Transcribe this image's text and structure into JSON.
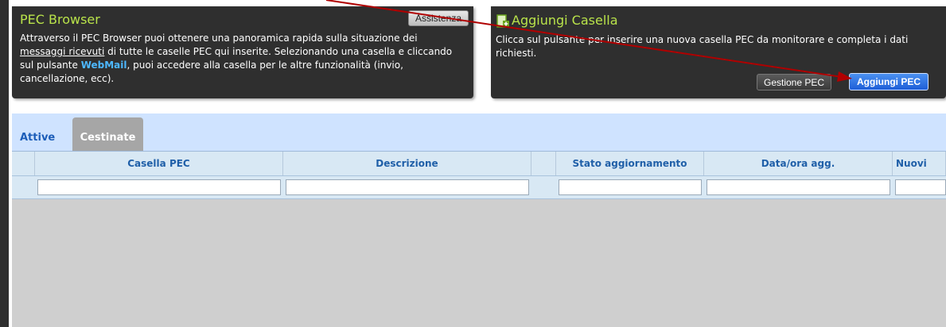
{
  "pec_browser": {
    "title": "PEC Browser",
    "assistenza_label": "Assistenza",
    "desc_part1": "Attraverso il PEC Browser puoi ottenere una panoramica rapida sulla situazione dei",
    "desc_link": "messaggi ricevuti",
    "desc_part2": " di tutte le caselle PEC qui inserite. Selezionando una casella e cliccando sul pulsante ",
    "desc_webmail": "WebMail",
    "desc_part3": ", puoi accedere alla casella per le altre funzionalità (invio, cancellazione, ecc)."
  },
  "aggiungi_casella": {
    "title": "Aggiungi Casella",
    "description": "Clicca sul pulsante per inserire una nuova casella PEC da monitorare e completa i dati richiesti.",
    "gestione_label": "Gestione PEC",
    "aggiungi_label": "Aggiungi PEC",
    "icon": "add-document-icon"
  },
  "tabs": [
    {
      "label": "Attive",
      "active": true
    },
    {
      "label": "Cestinate",
      "active": false
    }
  ],
  "grid": {
    "columns": [
      "",
      "Casella PEC",
      "Descrizione",
      "",
      "Stato aggiornamento",
      "Data/ora agg.",
      "Nuovi"
    ],
    "filter_values": [
      "",
      "",
      "",
      ""
    ]
  },
  "colors": {
    "panel_bg": "#2f2f2f",
    "title_green": "#b9e34a",
    "link_blue": "#4db8ff",
    "primary_button": "#1e5ed8",
    "tab_bar": "#cfe3ff",
    "header_text": "#1f5fa8",
    "annotation_arrow": "#b00000"
  }
}
